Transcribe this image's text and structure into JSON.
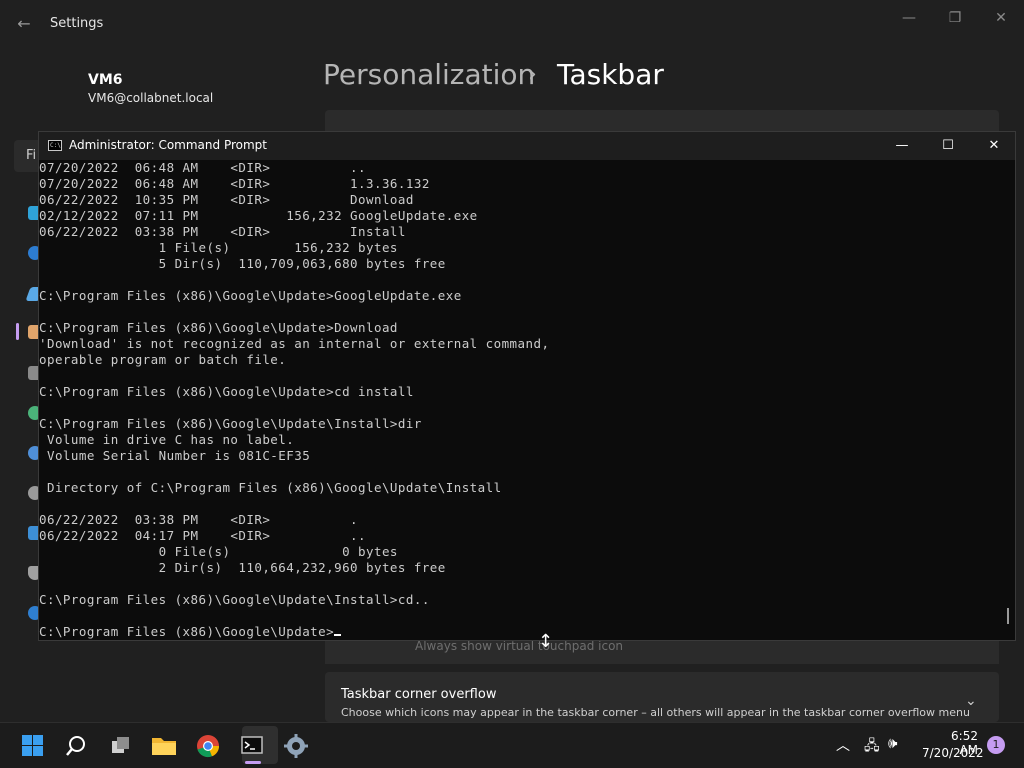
{
  "settings": {
    "title": "Settings",
    "user": {
      "name": "VM6",
      "email": "VM6@collabnet.local"
    },
    "breadcrumb": {
      "parent": "Personalization",
      "separator": "›",
      "current": "Taskbar"
    },
    "find_stub": "Fi",
    "behind_text": "Always show virtual touchpad icon",
    "overflow_card": {
      "title": "Taskbar corner overflow",
      "description": "Choose which icons may appear in the taskbar corner – all others will appear in the taskbar corner overflow menu"
    }
  },
  "cmd": {
    "title": "Administrator: Command Prompt",
    "lines": [
      "07/20/2022  06:48 AM    <DIR>          ..",
      "07/20/2022  06:48 AM    <DIR>          1.3.36.132",
      "06/22/2022  10:35 PM    <DIR>          Download",
      "02/12/2022  07:11 PM           156,232 GoogleUpdate.exe",
      "06/22/2022  03:38 PM    <DIR>          Install",
      "               1 File(s)        156,232 bytes",
      "               5 Dir(s)  110,709,063,680 bytes free",
      "",
      "C:\\Program Files (x86)\\Google\\Update>GoogleUpdate.exe",
      "",
      "C:\\Program Files (x86)\\Google\\Update>Download",
      "'Download' is not recognized as an internal or external command,",
      "operable program or batch file.",
      "",
      "C:\\Program Files (x86)\\Google\\Update>cd install",
      "",
      "C:\\Program Files (x86)\\Google\\Update\\Install>dir",
      " Volume in drive C has no label.",
      " Volume Serial Number is 081C-EF35",
      "",
      " Directory of C:\\Program Files (x86)\\Google\\Update\\Install",
      "",
      "06/22/2022  03:38 PM    <DIR>          .",
      "06/22/2022  04:17 PM    <DIR>          ..",
      "               0 File(s)              0 bytes",
      "               2 Dir(s)  110,664,232,960 bytes free",
      "",
      "C:\\Program Files (x86)\\Google\\Update\\Install>cd..",
      ""
    ],
    "prompt": "C:\\Program Files (x86)\\Google\\Update>"
  },
  "taskbar": {
    "clock_time": "6:52 AM",
    "clock_date": "7/20/2022",
    "notification_count": "1"
  },
  "colors": {
    "accent": "#c59cf1",
    "console_bg": "#0c0c0c",
    "console_fg": "#cccccc"
  }
}
